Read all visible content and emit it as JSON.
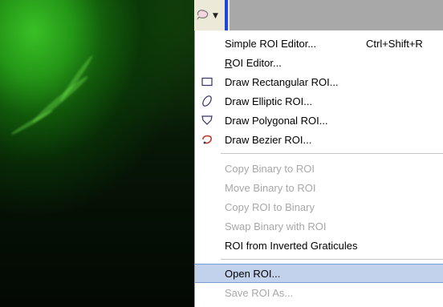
{
  "toolbar": {
    "roi_tool_icon": "roi-lasso-icon",
    "dropdown_icon": "chevron-down-icon",
    "accent_color": "#2145d6"
  },
  "menu": {
    "items": [
      {
        "label": "Simple ROI Editor...",
        "shortcut": "Ctrl+Shift+R",
        "icon": "",
        "enabled": true
      },
      {
        "label": "ROI Editor...",
        "shortcut": "",
        "icon": "",
        "enabled": true
      },
      {
        "label": "Draw Rectangular ROI...",
        "shortcut": "",
        "icon": "rectangle-roi-icon",
        "enabled": true
      },
      {
        "label": "Draw Elliptic ROI...",
        "shortcut": "",
        "icon": "ellipse-roi-icon",
        "enabled": true
      },
      {
        "label": "Draw Polygonal ROI...",
        "shortcut": "",
        "icon": "polygon-roi-icon",
        "enabled": true
      },
      {
        "label": "Draw Bezier ROI...",
        "shortcut": "",
        "icon": "bezier-roi-icon",
        "enabled": true
      },
      {
        "label": "Copy Binary to ROI",
        "shortcut": "",
        "icon": "",
        "enabled": false
      },
      {
        "label": "Move Binary to ROI",
        "shortcut": "",
        "icon": "",
        "enabled": false
      },
      {
        "label": "Copy ROI to Binary",
        "shortcut": "",
        "icon": "",
        "enabled": false
      },
      {
        "label": "Swap Binary with ROI",
        "shortcut": "",
        "icon": "",
        "enabled": false
      },
      {
        "label": "ROI from Inverted Graticules",
        "shortcut": "",
        "icon": "",
        "enabled": true
      },
      {
        "label": "Open ROI...",
        "shortcut": "",
        "icon": "",
        "enabled": true,
        "highlighted": true
      },
      {
        "label": "Save ROI As...",
        "shortcut": "",
        "icon": "",
        "enabled": false
      }
    ],
    "highlight_color": "#c2d2ec"
  },
  "image": {
    "description_colors": [
      "#0f2e0a",
      "#3cc828"
    ]
  }
}
